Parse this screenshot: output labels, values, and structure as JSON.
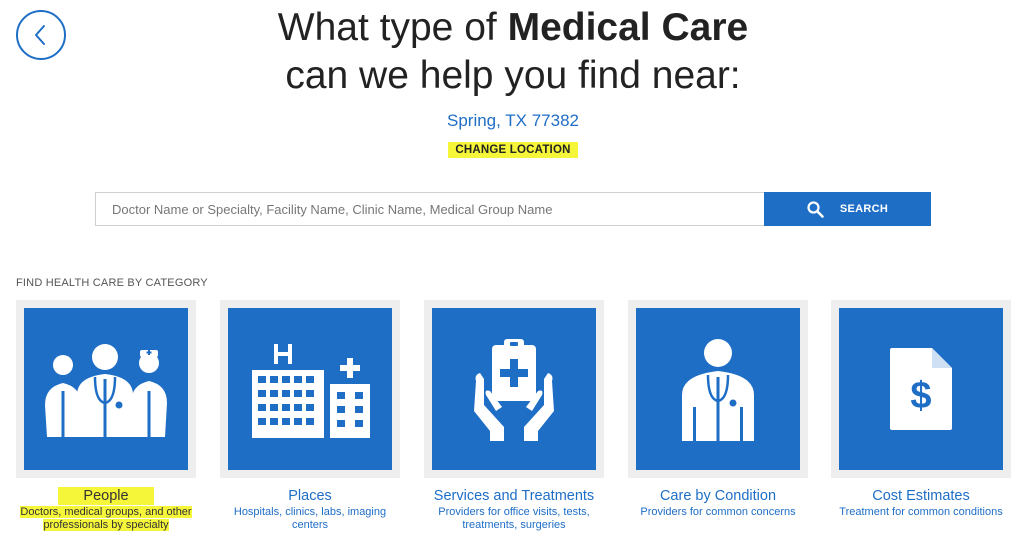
{
  "header": {
    "line1_prefix": "What type of",
    "line1_bold": "Medical Care",
    "line2": "can we help you find near:",
    "location": "Spring, TX 77382",
    "change_location": "CHANGE LOCATION"
  },
  "search": {
    "placeholder": "Doctor Name or Specialty, Facility Name, Clinic Name, Medical Group Name",
    "button_label": "SEARCH"
  },
  "categories": {
    "section_label": "FIND HEALTH CARE BY CATEGORY",
    "items": [
      {
        "title": "People",
        "description": "Doctors, medical groups, and other professionals by specialty",
        "icon": "people-icon"
      },
      {
        "title": "Places",
        "description": "Hospitals, clinics, labs, imaging centers",
        "icon": "buildings-icon"
      },
      {
        "title": "Services and Treatments",
        "description": "Providers for office visits, tests, treatments, surgeries",
        "icon": "clipboard-hands-icon"
      },
      {
        "title": "Care by Condition",
        "description": "Providers for common concerns",
        "icon": "doctor-icon"
      },
      {
        "title": "Cost Estimates",
        "description": "Treatment for common conditions",
        "icon": "dollar-document-icon"
      }
    ]
  },
  "colors": {
    "brand_blue": "#1f6ec6",
    "highlight": "#f5f53a",
    "tile_frame": "#eeeeee"
  }
}
